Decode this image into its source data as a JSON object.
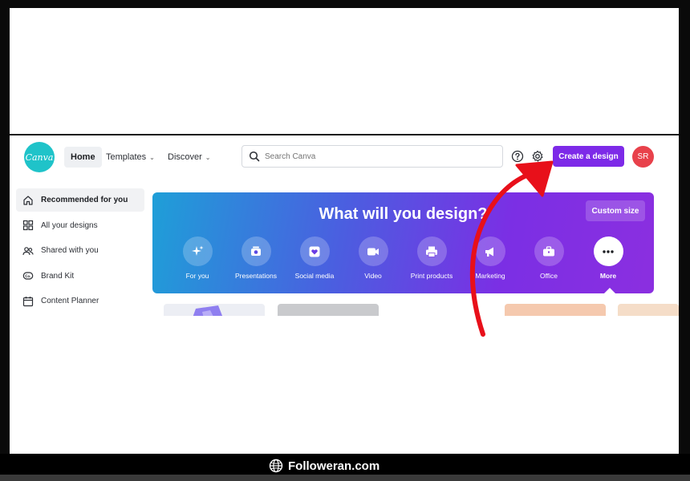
{
  "header": {
    "logo_text": "Canva",
    "nav": {
      "home": "Home",
      "templates": "Templates",
      "discover": "Discover"
    },
    "search_placeholder": "Search Canva",
    "create_button": "Create a design",
    "avatar_initials": "SR"
  },
  "sidebar": {
    "items": [
      {
        "label": "Recommended for you",
        "icon": "home-icon"
      },
      {
        "label": "All your designs",
        "icon": "grid-icon"
      },
      {
        "label": "Shared with you",
        "icon": "people-icon"
      },
      {
        "label": "Brand Kit",
        "icon": "brand-kit-icon"
      },
      {
        "label": "Content Planner",
        "icon": "calendar-icon"
      }
    ]
  },
  "hero": {
    "title": "What will you design?",
    "custom_size": "Custom size",
    "categories": [
      {
        "label": "For you",
        "icon": "sparkle-icon"
      },
      {
        "label": "Presentations",
        "icon": "presentation-icon"
      },
      {
        "label": "Social media",
        "icon": "heart-icon"
      },
      {
        "label": "Video",
        "icon": "video-icon"
      },
      {
        "label": "Print products",
        "icon": "printer-icon"
      },
      {
        "label": "Marketing",
        "icon": "megaphone-icon"
      },
      {
        "label": "Office",
        "icon": "briefcase-icon"
      },
      {
        "label": "More",
        "icon": "more-icon"
      }
    ]
  },
  "colors": {
    "accent": "#7d2ae8",
    "logo": "#1fc3c9",
    "avatar": "#e8414b",
    "annotation_arrow": "#e8101a"
  },
  "footer": {
    "brand": "Followeran.com"
  }
}
